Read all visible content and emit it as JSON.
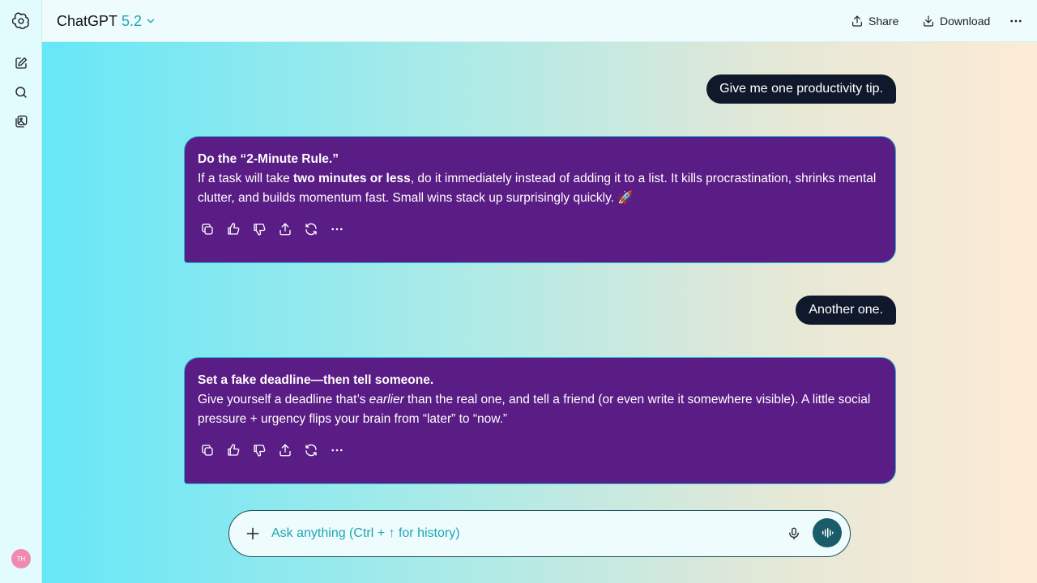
{
  "header": {
    "app_name": "ChatGPT",
    "model_version": "5.2",
    "share_label": "Share",
    "download_label": "Download"
  },
  "sidebar": {
    "items": [
      {
        "icon": "new-chat-icon"
      },
      {
        "icon": "search-icon"
      },
      {
        "icon": "images-icon"
      }
    ],
    "avatar_initials": "TH"
  },
  "messages": [
    {
      "role": "user",
      "text": "Give me one productivity tip."
    },
    {
      "role": "assistant",
      "title": "Do the “2-Minute Rule.”",
      "body_pre": "If a task will take ",
      "body_bold": "two minutes or less",
      "body_post": ", do it immediately instead of adding it to a list. It kills procrastination, shrinks mental clutter, and builds momentum fast. Small wins stack up surprisingly quickly. 🚀"
    },
    {
      "role": "user",
      "text": "Another one."
    },
    {
      "role": "assistant",
      "title": "Set a fake deadline—then tell someone.",
      "body_pre": "Give yourself a deadline that’s ",
      "body_italic": "earlier",
      "body_post": " than the real one, and tell a friend (or even write it somewhere visible). A little social pressure + urgency flips your brain from “later” to “now.”"
    }
  ],
  "composer": {
    "placeholder": "Ask anything (Ctrl + ↑ for history)",
    "value": ""
  },
  "colors": {
    "user_bubble": "#10192c",
    "assistant_bubble": "#5a1c85",
    "assistant_border": "#2bb6d6",
    "accent": "#1aa6b8"
  }
}
